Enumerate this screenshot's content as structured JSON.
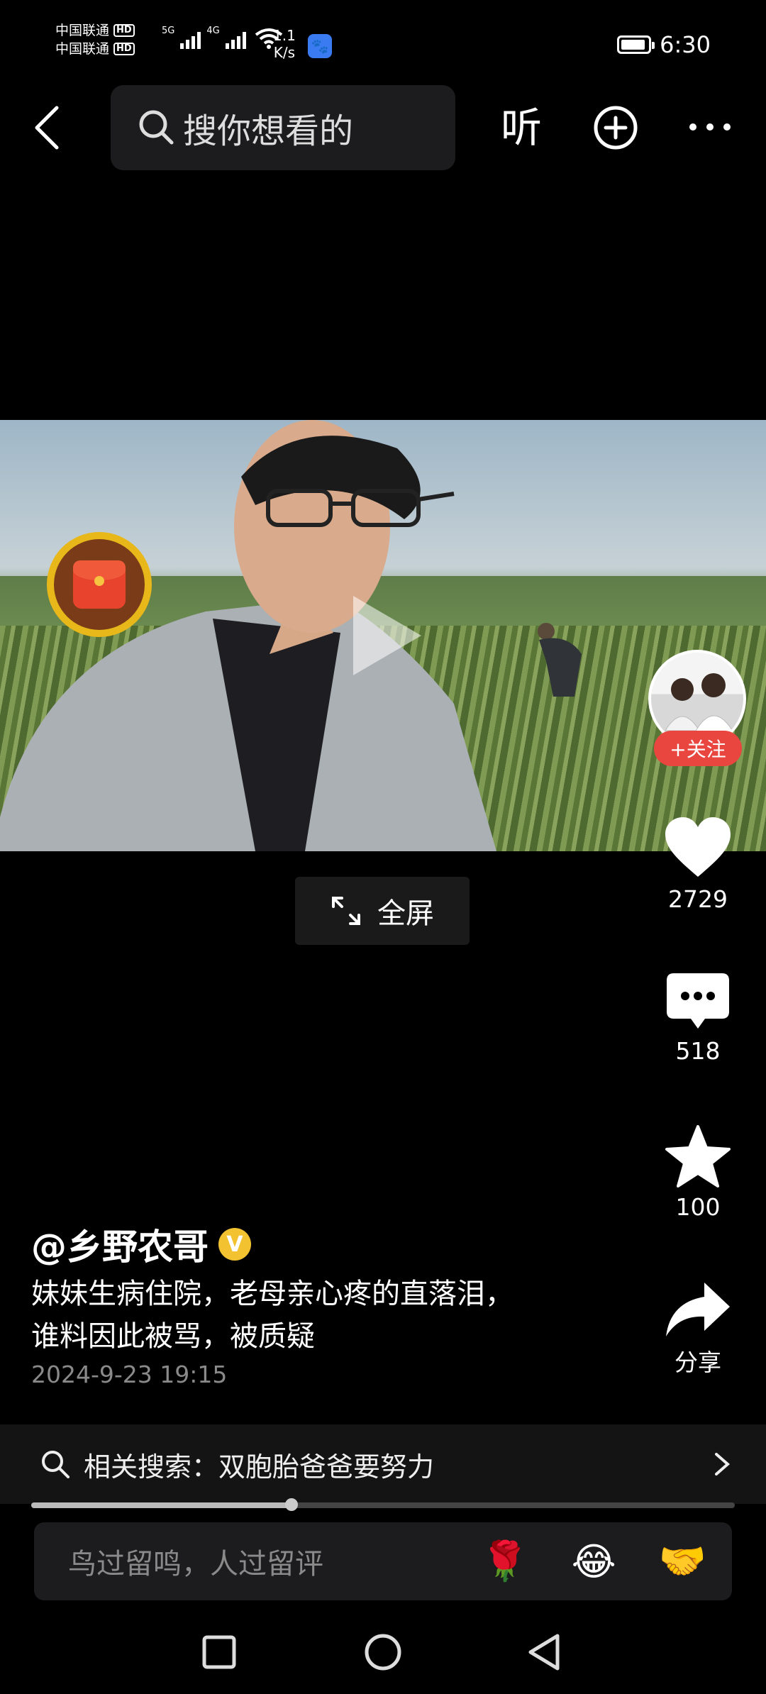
{
  "status_bar": {
    "carrier1": "中国联通",
    "carrier2": "中国联通",
    "hd": "HD",
    "net5g": "5G",
    "net4g": "4G",
    "speed_value": "1.1",
    "speed_unit": "K/s",
    "time": "6:30"
  },
  "top_bar": {
    "search_placeholder": "搜你想看的",
    "listen_label": "听"
  },
  "video": {
    "fullscreen_label": "全屏"
  },
  "author": {
    "name": "@乡野农哥",
    "verified_badge": "V",
    "follow_label": "+关注"
  },
  "actions": {
    "likes": "2729",
    "comments": "518",
    "favorites": "100",
    "share_label": "分享"
  },
  "caption": {
    "line1": "妹妹生病住院，老母亲心疼的直落泪，",
    "line2": "谁料因此被骂，被质疑",
    "date": "2024-9-23 19:15"
  },
  "related_search": {
    "text": "相关搜索：双胞胎爸爸要努力"
  },
  "progress": {
    "played_fraction": 0.37
  },
  "comment_box": {
    "placeholder": "鸟过留鸣，人过留评",
    "emoji1": "🌹",
    "emoji2": "😂",
    "emoji3": "🤝"
  }
}
